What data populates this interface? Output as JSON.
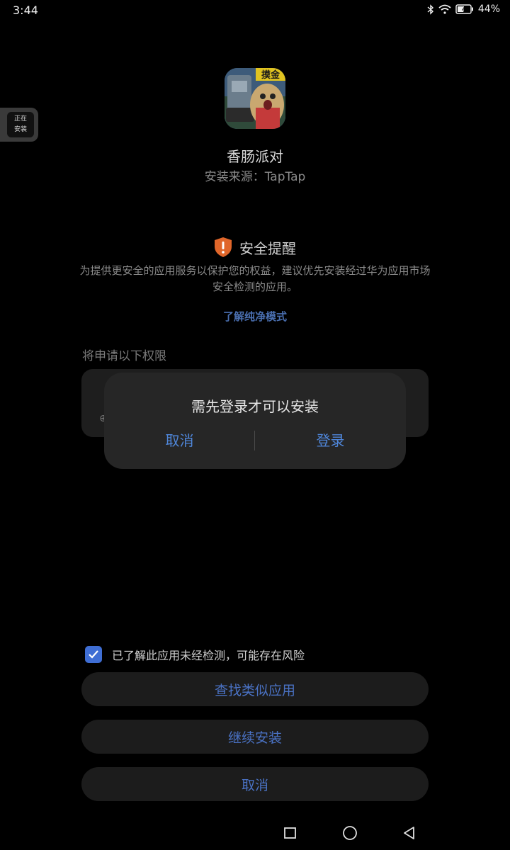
{
  "status_bar": {
    "time": "3:44",
    "battery": "44%"
  },
  "side_tag": {
    "line1": "正在",
    "line2": "安装"
  },
  "app": {
    "name": "香肠派对",
    "icon_badge": "摸金",
    "source_label": "安装来源：",
    "source_value": "TapTap"
  },
  "security": {
    "title": "安全提醒",
    "description": "为提供更安全的应用服务以保护您的权益，建议优先安装经过华为应用市场安全检测的应用。",
    "learn_more": "了解纯净模式"
  },
  "permissions": {
    "heading": "将申请以下权限"
  },
  "dialog": {
    "message": "需先登录才可以安装",
    "cancel": "取消",
    "login": "登录"
  },
  "bottom": {
    "checkbox_label": "已了解此应用未经检测，可能存在风险",
    "checkbox_checked": true,
    "find_similar": "查找类似应用",
    "continue_install": "继续安装",
    "cancel": "取消"
  },
  "colors": {
    "accent": "#4f86d9",
    "checkbox": "#3f6ed4",
    "shield": "#e0662a"
  }
}
